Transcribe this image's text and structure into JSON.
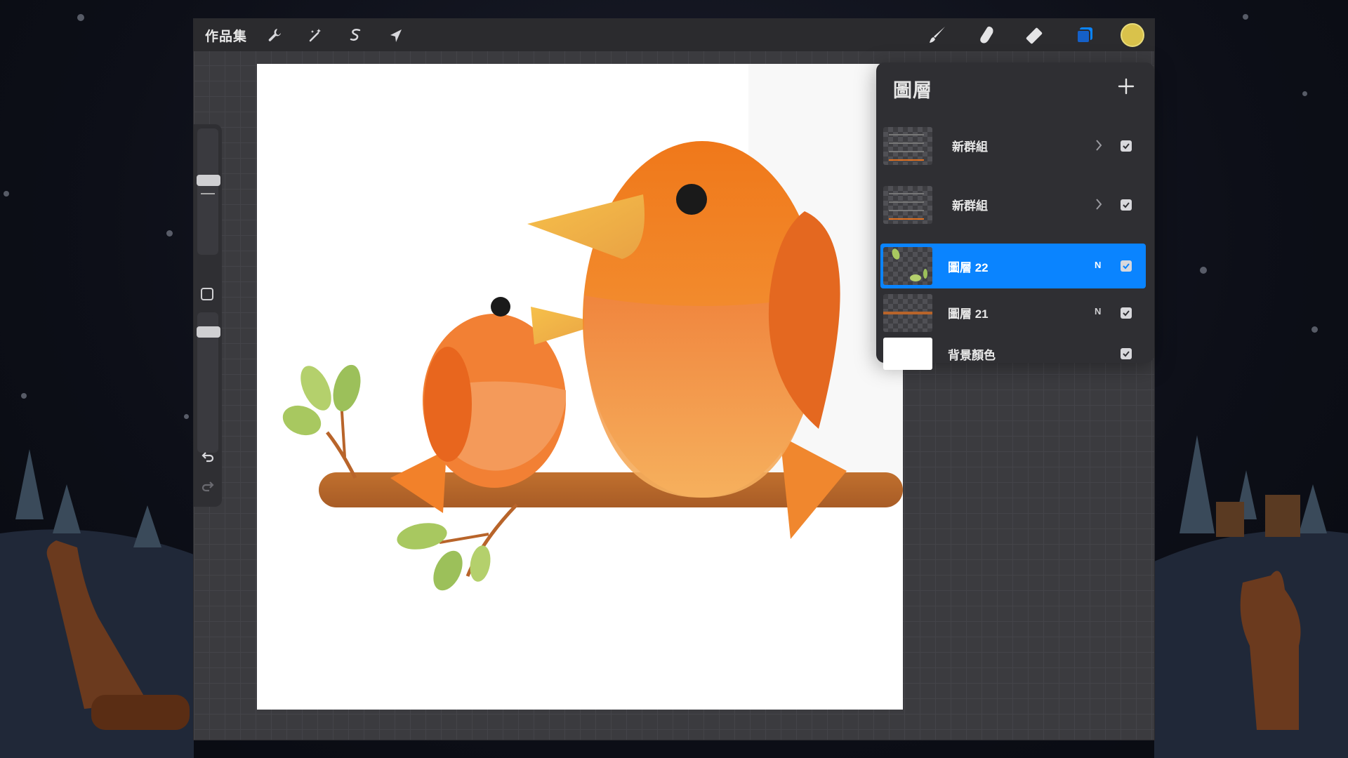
{
  "topbar": {
    "gallery_label": "作品集",
    "left_tools": [
      {
        "name": "actions",
        "icon": "wrench-icon"
      },
      {
        "name": "adjustments",
        "icon": "magic-wand-icon"
      },
      {
        "name": "selection",
        "icon": "selection-s-icon"
      },
      {
        "name": "transform",
        "icon": "arrow-cursor-icon"
      }
    ],
    "right_tools": [
      {
        "name": "brush",
        "icon": "brush-icon"
      },
      {
        "name": "smudge",
        "icon": "smudge-finger-icon"
      },
      {
        "name": "eraser",
        "icon": "eraser-icon"
      },
      {
        "name": "layers",
        "icon": "layers-icon",
        "active": true
      }
    ],
    "current_color": "#d9c24b"
  },
  "sidebar": {
    "brush_size_icon": "slider-knob",
    "opacity_icon": "slider-knob",
    "modify_button_icon": "square-icon",
    "undo_icon": "undo-icon",
    "redo_icon": "redo-icon"
  },
  "layers_panel": {
    "title": "圖層",
    "add_icon": "plus-icon",
    "layers": [
      {
        "name": "新群組",
        "type": "group",
        "expand_icon": "chevron-right-icon",
        "visible": true
      },
      {
        "name": "新群組",
        "type": "group",
        "expand_icon": "chevron-right-icon",
        "visible": true
      },
      {
        "name": "圖層 22",
        "type": "layer",
        "blend": "N",
        "visible": true,
        "active": true
      },
      {
        "name": "圖層 21",
        "type": "layer",
        "blend": "N",
        "visible": true
      },
      {
        "name": "背景顏色",
        "type": "background",
        "visible": true
      }
    ]
  },
  "colors": {
    "accent": "#0a84ff",
    "bird_orange": "#f08020",
    "branch": "#b8642a",
    "leaf": "#a8c860"
  }
}
